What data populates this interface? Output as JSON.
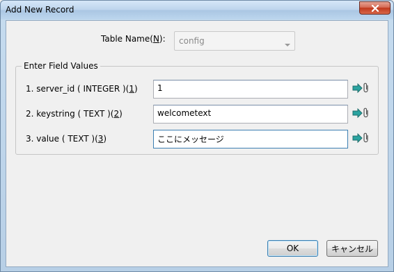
{
  "window": {
    "title": "Add New Record"
  },
  "table_name": {
    "label_prefix": "Table Name(",
    "label_mnemonic": "N",
    "label_suffix": "):",
    "value": "config"
  },
  "group": {
    "title": "Enter Field Values",
    "rows": [
      {
        "label": "1. server_id ( INTEGER )(",
        "mnemonic": "1",
        "label_end": ")",
        "value": "1"
      },
      {
        "label": "2. keystring ( TEXT )(",
        "mnemonic": "2",
        "label_end": ")",
        "value": "welcometext"
      },
      {
        "label": "3. value ( TEXT )(",
        "mnemonic": "3",
        "label_end": ")",
        "value": "ここにメッセージ"
      }
    ]
  },
  "buttons": {
    "ok": "OK",
    "cancel": "キャンセル"
  },
  "colors": {
    "accent": "#3c7fb1",
    "close": "#c0391d",
    "arrow_icon": "#2aa3a0"
  },
  "icons": [
    "close-icon",
    "combo-arrow-icon",
    "insert-arrow-icon",
    "paperclip-icon"
  ]
}
